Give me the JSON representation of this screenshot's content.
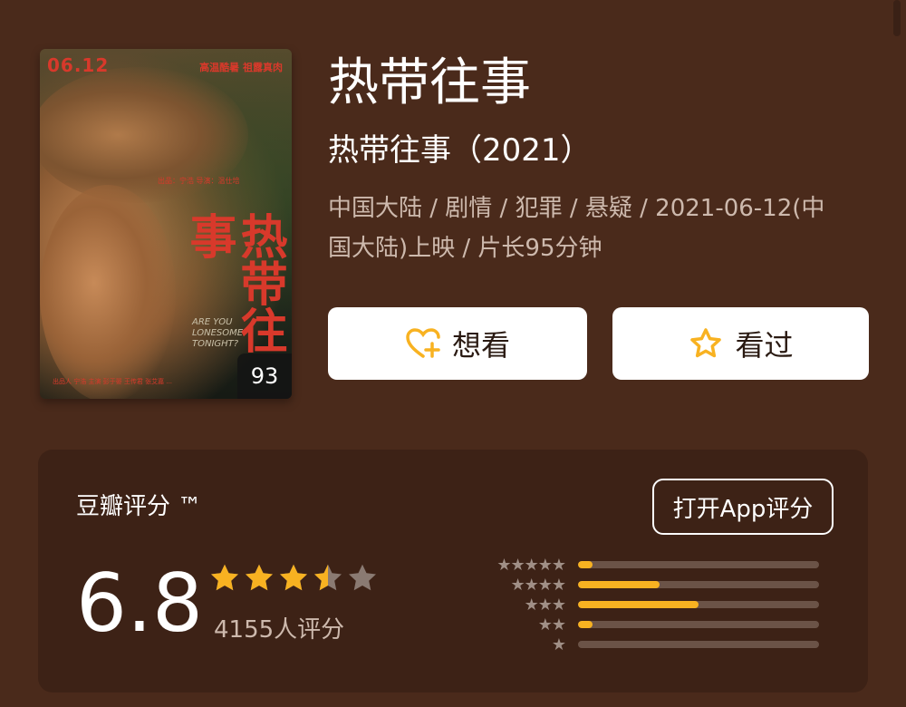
{
  "poster": {
    "date": "06.12",
    "tagline": "高温酷暑  祖露真肉",
    "director_credit": "出品：宁浩    导演：温仕培",
    "title_cn": "热带往事",
    "title_en": "ARE YOU LONESOME TONIGHT?",
    "bottom_credits": "出品人 宁浩 主演 彭于晏 王传君 张艾嘉 ...",
    "score_badge": "93"
  },
  "movie": {
    "title": "热带往事",
    "subtitle": "热带往事（2021）",
    "meta": "中国大陆 / 剧情 / 犯罪 / 悬疑 / 2021-06-12(中国大陆)上映 / 片长95分钟"
  },
  "actions": {
    "want_label": "想看",
    "seen_label": "看过"
  },
  "rating": {
    "label": "豆瓣评分 ™",
    "open_app_label": "打开App评分",
    "score": "6.8",
    "stars_value": 3.5,
    "stars_max": 5,
    "count_text": "4155人评分",
    "distribution": [
      {
        "stars": "★★★★★",
        "fraction": 0.06
      },
      {
        "stars": "★★★★",
        "fraction": 0.34
      },
      {
        "stars": "★★★",
        "fraction": 0.5
      },
      {
        "stars": "★★",
        "fraction": 0.06
      },
      {
        "stars": "★",
        "fraction": 0.0
      }
    ]
  },
  "colors": {
    "background": "#4a2a1b",
    "card": "#3d2216",
    "accent_star": "#f8b221",
    "muted_text": "#cdb9ad"
  }
}
